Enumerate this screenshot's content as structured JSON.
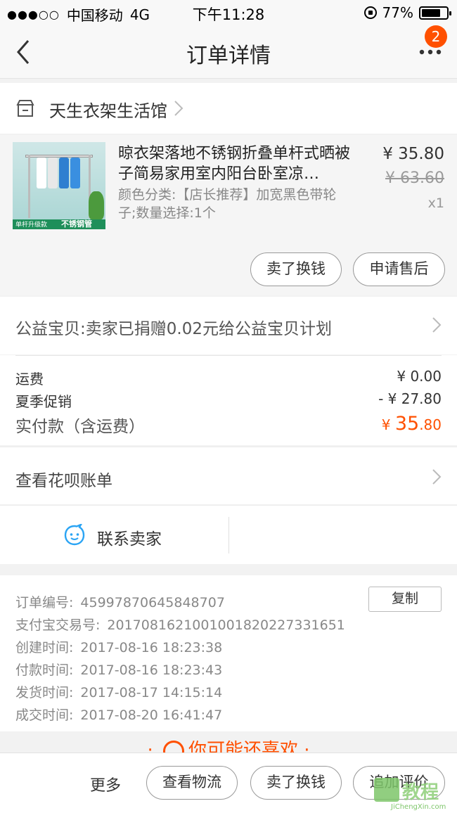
{
  "status_bar": {
    "carrier": "中国移动",
    "network": "4G",
    "time": "下午11:28",
    "battery": "77%",
    "battery_level": 0.77
  },
  "nav": {
    "title": "订单详情",
    "badge_count": "2"
  },
  "shop": {
    "name": "天生衣架生活馆"
  },
  "product": {
    "title": "晾衣架落地不锈钢折叠单杆式晒被子简易家用室内阳台卧室凉…",
    "sku": "颜色分类:【店长推荐】加宽黑色带轮子;数量选择:1个",
    "price": "¥ 35.80",
    "original_price": "¥ 63.60",
    "quantity": "x1",
    "thumb_strip_left": "单杆升级款",
    "thumb_strip_right": "不锈钢管",
    "buttons": {
      "resell": "卖了换钱",
      "after_sale": "申请售后"
    }
  },
  "charity": {
    "text": "公益宝贝:卖家已捐赠0.02元给公益宝贝计划"
  },
  "fees": {
    "shipping_label": "运费",
    "shipping_value": "¥ 0.00",
    "promo_label": "夏季促销",
    "promo_value": "- ¥ 27.80",
    "total_label": "实付款（含运费）",
    "total_currency": "¥",
    "total_int": "35",
    "total_dec": ".80"
  },
  "huabei": {
    "text": "查看花呗账单"
  },
  "contact": {
    "text": "联系卖家"
  },
  "order_info": {
    "copy_label": "复制",
    "lines": [
      {
        "k": "订单编号:",
        "v": "45997870645848707"
      },
      {
        "k": "支付宝交易号:",
        "v": "2017081621001001820227331651"
      },
      {
        "k": "创建时间:",
        "v": "2017-08-16 18:23:38"
      },
      {
        "k": "付款时间:",
        "v": "2017-08-16 18:23:43"
      },
      {
        "k": "发货时间:",
        "v": "2017-08-17 14:15:14"
      },
      {
        "k": "成交时间:",
        "v": "2017-08-20 16:41:47"
      }
    ]
  },
  "guess": {
    "text": "你可能还喜欢"
  },
  "bottom": {
    "more": "更多",
    "logistics": "查看物流",
    "resell": "卖了换钱",
    "review": "追加评价"
  },
  "watermark": {
    "text": "教程",
    "url": "JiChengXin.com"
  },
  "colors": {
    "accent": "#ff5000",
    "contact_icon": "#2aa4f4"
  }
}
